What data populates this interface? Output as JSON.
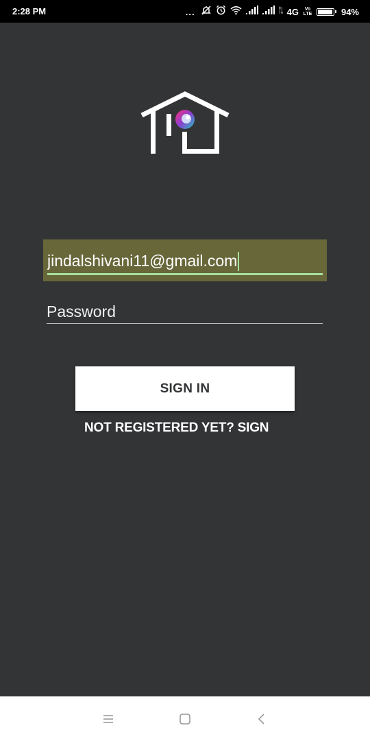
{
  "status_bar": {
    "time": "2:28 PM",
    "dots": "...",
    "network": "4G",
    "volte": "Vo LTE",
    "battery_percent": "94%",
    "battery_level": 0.94
  },
  "login": {
    "email_value": "jindalshivani11@gmail.com",
    "password_placeholder": "Password",
    "sign_in_label": "SIGN IN",
    "register_link": "NOT REGISTERED YET? SIGN"
  },
  "colors": {
    "background": "#333436",
    "email_highlight": "#67673a",
    "accent_underline": "#a6e0a0"
  },
  "icons": {
    "logo": "house-camera-logo-icon",
    "nav_menu": "menu-icon",
    "nav_home": "home-square-icon",
    "nav_back": "back-chevron-icon"
  }
}
